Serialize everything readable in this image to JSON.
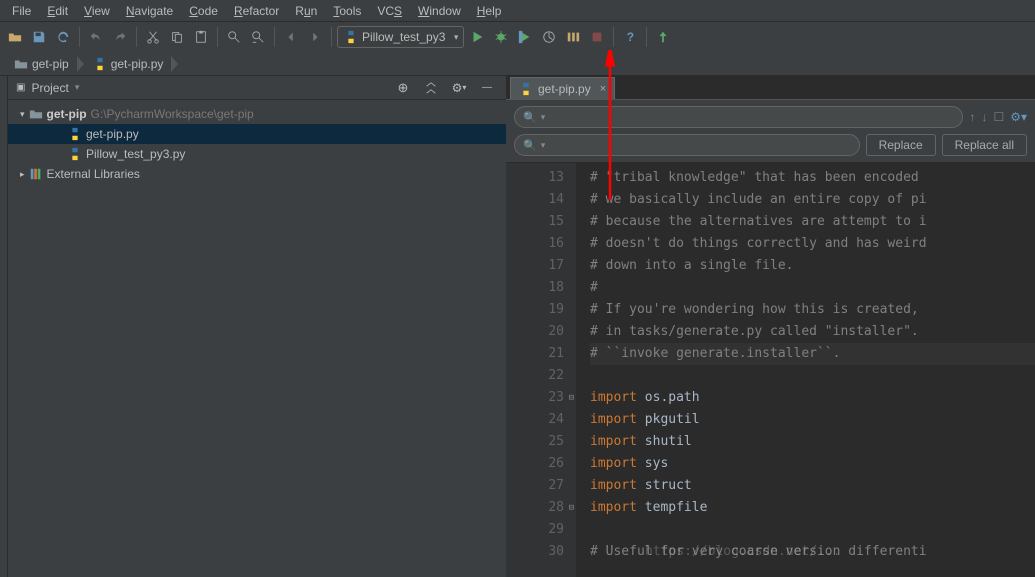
{
  "menu": [
    "File",
    "Edit",
    "View",
    "Navigate",
    "Code",
    "Refactor",
    "Run",
    "Tools",
    "VCS",
    "Window",
    "Help"
  ],
  "runConfig": {
    "label": "Pillow_test_py3"
  },
  "breadcrumb": [
    {
      "label": "get-pip",
      "icon": "folder"
    },
    {
      "label": "get-pip.py",
      "icon": "python"
    }
  ],
  "projectPanel": {
    "title": "Project"
  },
  "tree": {
    "root": {
      "name": "get-pip",
      "path": "G:\\PycharmWorkspace\\get-pip"
    },
    "files": [
      "get-pip.py",
      "Pillow_test_py3.py"
    ],
    "externalLibs": "External Libraries"
  },
  "editorTab": {
    "name": "get-pip.py"
  },
  "searchButtons": {
    "replace": "Replace",
    "replaceAll": "Replace all"
  },
  "code": {
    "startLine": 13,
    "endLine": 30,
    "foldLines": [
      23,
      28
    ],
    "lines": [
      {
        "n": 13,
        "type": "comment",
        "text": "# \"tribal knowledge\" that has been encoded "
      },
      {
        "n": 14,
        "type": "comment",
        "text": "# we basically include an entire copy of pi"
      },
      {
        "n": 15,
        "type": "comment",
        "text": "# because the alternatives are attempt to i"
      },
      {
        "n": 16,
        "type": "comment",
        "text": "# doesn't do things correctly and has weird"
      },
      {
        "n": 17,
        "type": "comment",
        "text": "# down into a single file."
      },
      {
        "n": 18,
        "type": "comment",
        "text": "#"
      },
      {
        "n": 19,
        "type": "comment",
        "text": "# If you're wondering how this is created, "
      },
      {
        "n": 20,
        "type": "comment",
        "text": "# in tasks/generate.py called \"installer\". "
      },
      {
        "n": 21,
        "type": "comment",
        "text": "# ``invoke generate.installer``."
      },
      {
        "n": 22,
        "type": "blank",
        "text": ""
      },
      {
        "n": 23,
        "type": "import",
        "kw": "import",
        "mod": "os.path"
      },
      {
        "n": 24,
        "type": "import",
        "kw": "import",
        "mod": "pkgutil"
      },
      {
        "n": 25,
        "type": "import",
        "kw": "import",
        "mod": "shutil"
      },
      {
        "n": 26,
        "type": "import",
        "kw": "import",
        "mod": "sys"
      },
      {
        "n": 27,
        "type": "import",
        "kw": "import",
        "mod": "struct"
      },
      {
        "n": 28,
        "type": "import",
        "kw": "import",
        "mod": "tempfile"
      },
      {
        "n": 29,
        "type": "blank",
        "text": ""
      },
      {
        "n": 30,
        "type": "comment",
        "text": "# Useful for very coarse version differenti"
      }
    ]
  },
  "watermark": "https://blog.csdn.net/..."
}
